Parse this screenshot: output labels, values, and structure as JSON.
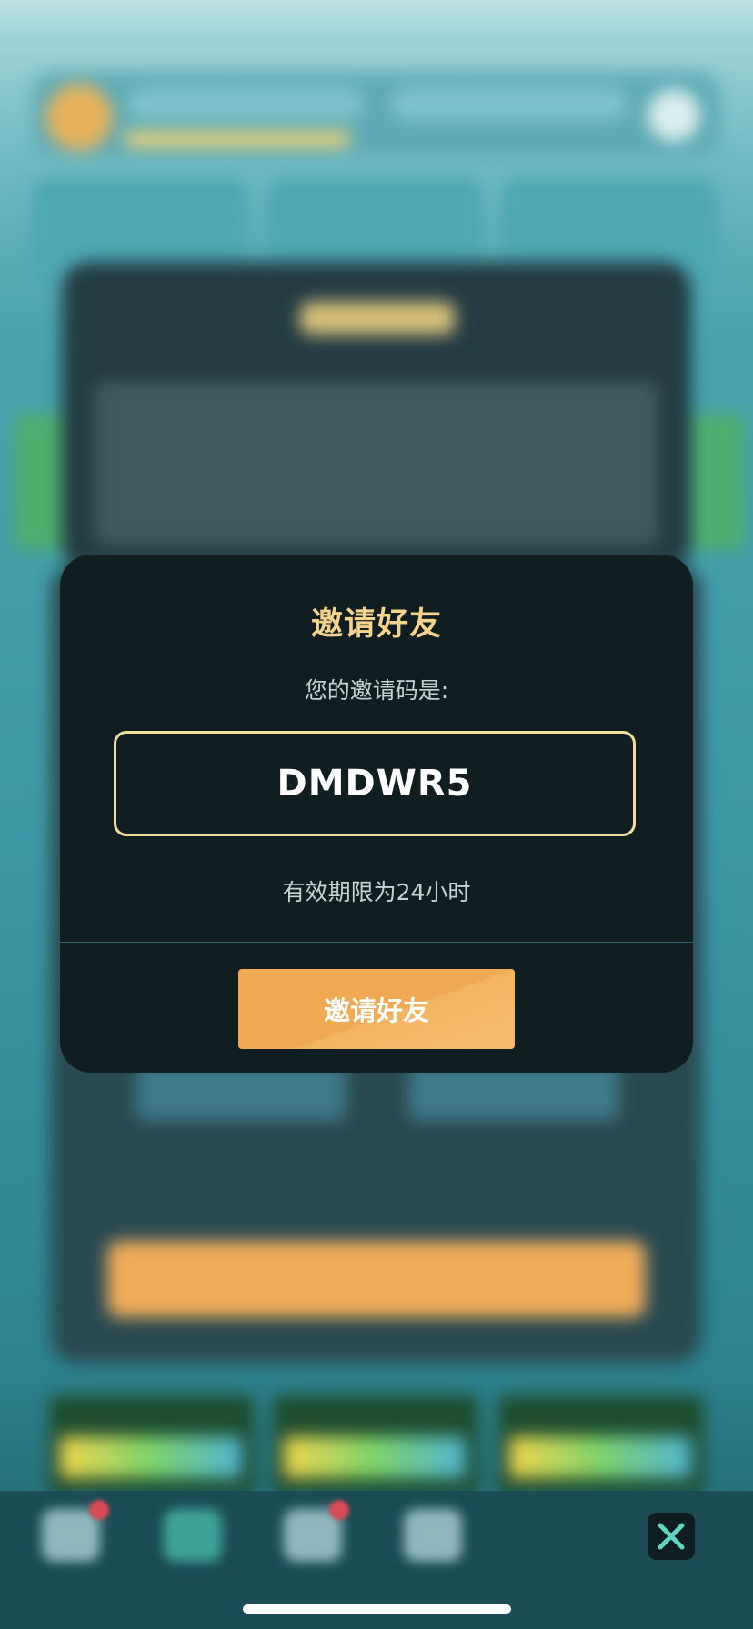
{
  "modal": {
    "title": "邀请好友",
    "code_label": "您的邀请码是:",
    "invite_code": "DMDWR5",
    "validity_note": "有效期限为24小时",
    "invite_button_label": "邀请好友"
  },
  "close_button": {
    "icon": "close-icon"
  },
  "colors": {
    "title_gold": "#f5d38b",
    "code_border": "#f0dd9a",
    "button_orange": "#efaa53",
    "modal_bg": "#111c1f",
    "close_icon_teal": "#5fd6c2"
  }
}
